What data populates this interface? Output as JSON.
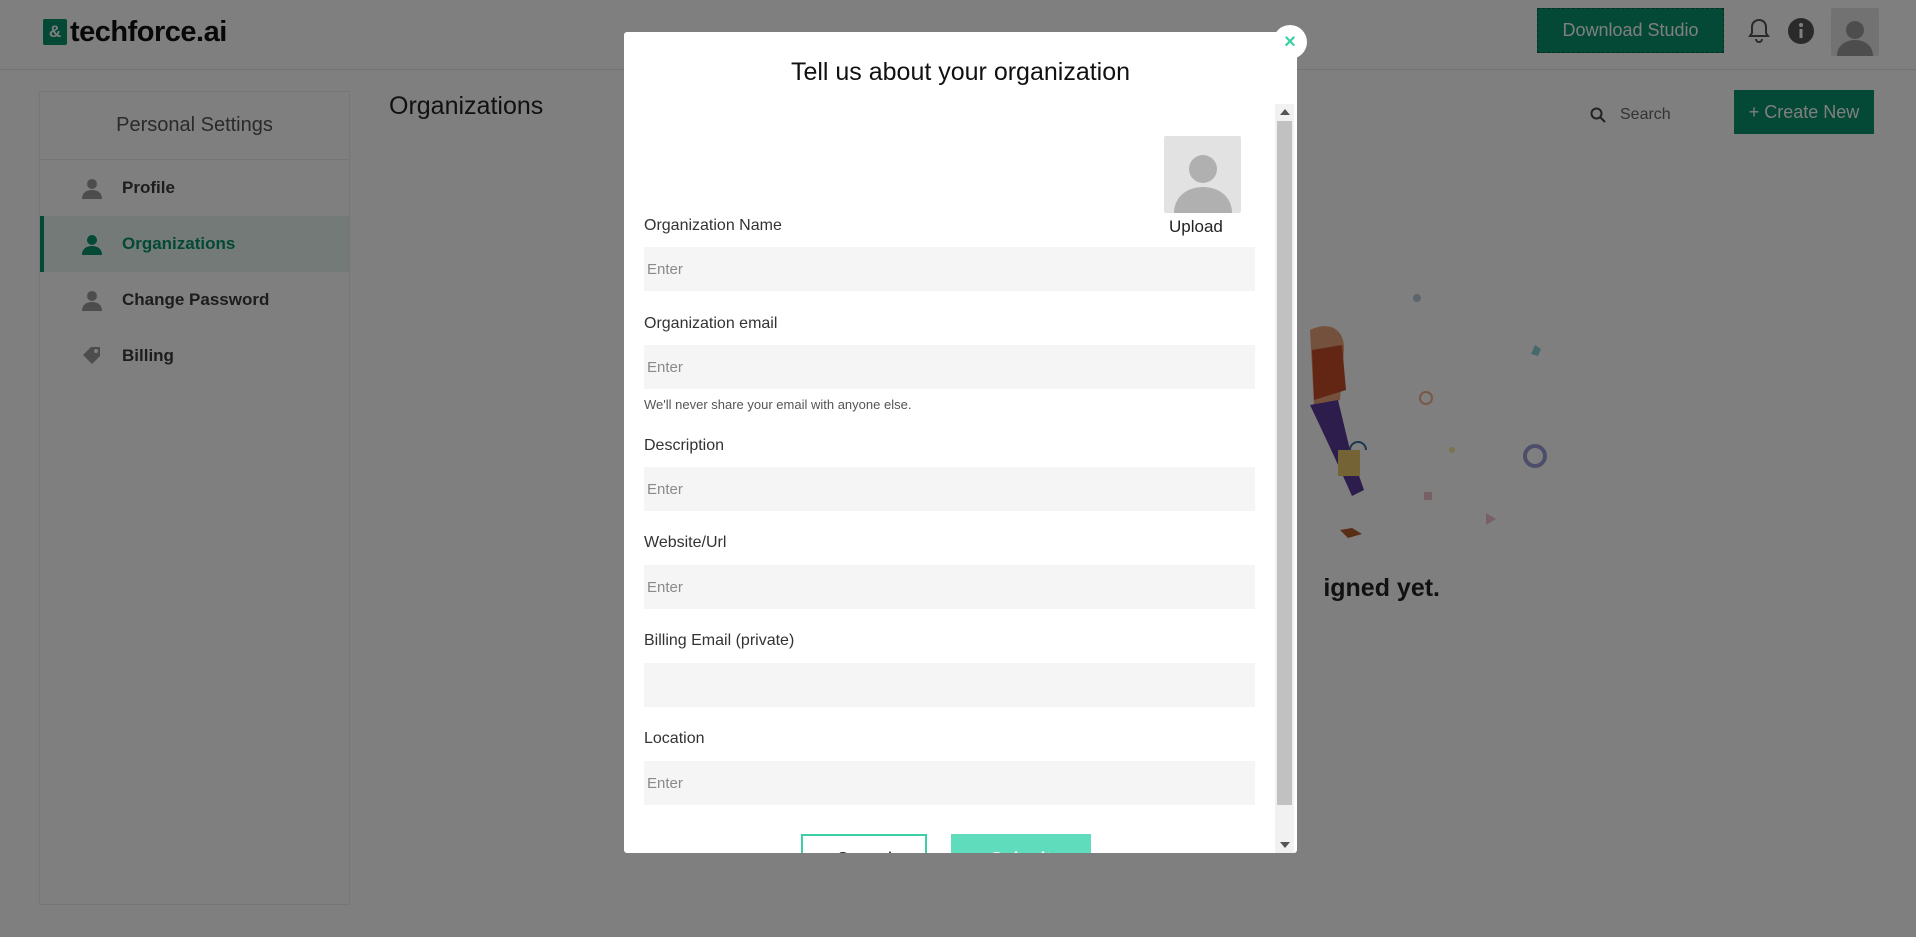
{
  "header": {
    "logo_mark": "&",
    "logo_text": "techforce.ai",
    "download_label": "Download Studio",
    "icons": [
      "bell-icon",
      "info-icon",
      "user-avatar-icon"
    ]
  },
  "sidebar": {
    "title": "Personal Settings",
    "items": [
      {
        "label": "Profile",
        "icon": "user-icon",
        "active": false
      },
      {
        "label": "Organizations",
        "icon": "user-icon",
        "active": true
      },
      {
        "label": "Change Password",
        "icon": "user-icon",
        "active": false
      },
      {
        "label": "Billing",
        "icon": "tag-icon",
        "active": false
      }
    ]
  },
  "main": {
    "title": "Organizations",
    "search_placeholder": "Search",
    "create_label": "+ Create New",
    "empty_text": "igned yet."
  },
  "modal": {
    "title": "Tell us about your organization",
    "close_symbol": "×",
    "upload_label": "Upload",
    "fields": {
      "org_name": {
        "label": "Organization Name",
        "placeholder": "Enter",
        "value": ""
      },
      "org_email": {
        "label": "Organization email",
        "placeholder": "Enter",
        "value": ""
      },
      "email_help": "We'll never share your email with anyone else.",
      "description": {
        "label": "Description",
        "placeholder": "Enter",
        "value": ""
      },
      "website": {
        "label": "Website/Url",
        "placeholder": "Enter",
        "value": ""
      },
      "billing_email": {
        "label": "Billing Email (private)",
        "placeholder": "",
        "value": ""
      },
      "location": {
        "label": "Location",
        "placeholder": "Enter",
        "value": ""
      }
    },
    "cancel_label": "Cancel",
    "submit_label": "Submit"
  },
  "colors": {
    "brand": "#07936a",
    "accent": "#3ccfa5",
    "submit": "#5fdcbb"
  }
}
